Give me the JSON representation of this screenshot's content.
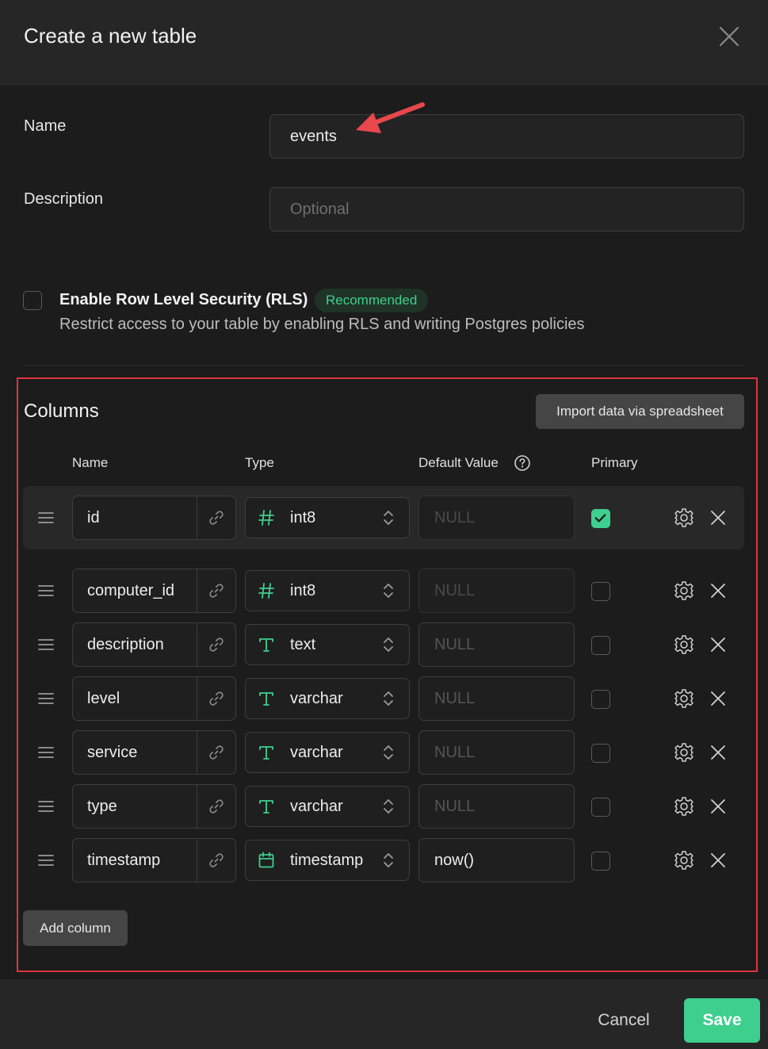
{
  "dialog": {
    "title": "Create a new table"
  },
  "form": {
    "name_label": "Name",
    "name_value": "events",
    "description_label": "Description",
    "description_placeholder": "Optional"
  },
  "rls": {
    "checked": false,
    "title": "Enable Row Level Security (RLS)",
    "badge": "Recommended",
    "description": "Restrict access to your table by enabling RLS and writing Postgres policies"
  },
  "columns": {
    "title": "Columns",
    "import_button": "Import data via spreadsheet",
    "headers": {
      "name": "Name",
      "type": "Type",
      "default_value": "Default Value",
      "primary": "Primary"
    },
    "rows": [
      {
        "name": "id",
        "type": "int8",
        "type_icon": "hash-icon",
        "default": "NULL",
        "default_disabled": true,
        "primary": true
      },
      {
        "name": "computer_id",
        "type": "int8",
        "type_icon": "hash-icon",
        "default": "NULL",
        "default_disabled": true,
        "primary": false
      },
      {
        "name": "description",
        "type": "text",
        "type_icon": "text-type-icon",
        "default": "NULL",
        "default_disabled": false,
        "primary": false
      },
      {
        "name": "level",
        "type": "varchar",
        "type_icon": "text-type-icon",
        "default": "NULL",
        "default_disabled": false,
        "primary": false
      },
      {
        "name": "service",
        "type": "varchar",
        "type_icon": "text-type-icon",
        "default": "NULL",
        "default_disabled": false,
        "primary": false
      },
      {
        "name": "type",
        "type": "varchar",
        "type_icon": "text-type-icon",
        "default": "NULL",
        "default_disabled": false,
        "primary": false
      },
      {
        "name": "timestamp",
        "type": "timestamp",
        "type_icon": "calendar-icon",
        "default": "now()",
        "default_disabled": false,
        "primary": false
      }
    ],
    "add_button": "Add column"
  },
  "footer": {
    "cancel": "Cancel",
    "save": "Save"
  },
  "colors": {
    "accent": "#3ecf8e",
    "highlight_border": "#e0343d",
    "annotation_arrow": "#e8474c"
  }
}
